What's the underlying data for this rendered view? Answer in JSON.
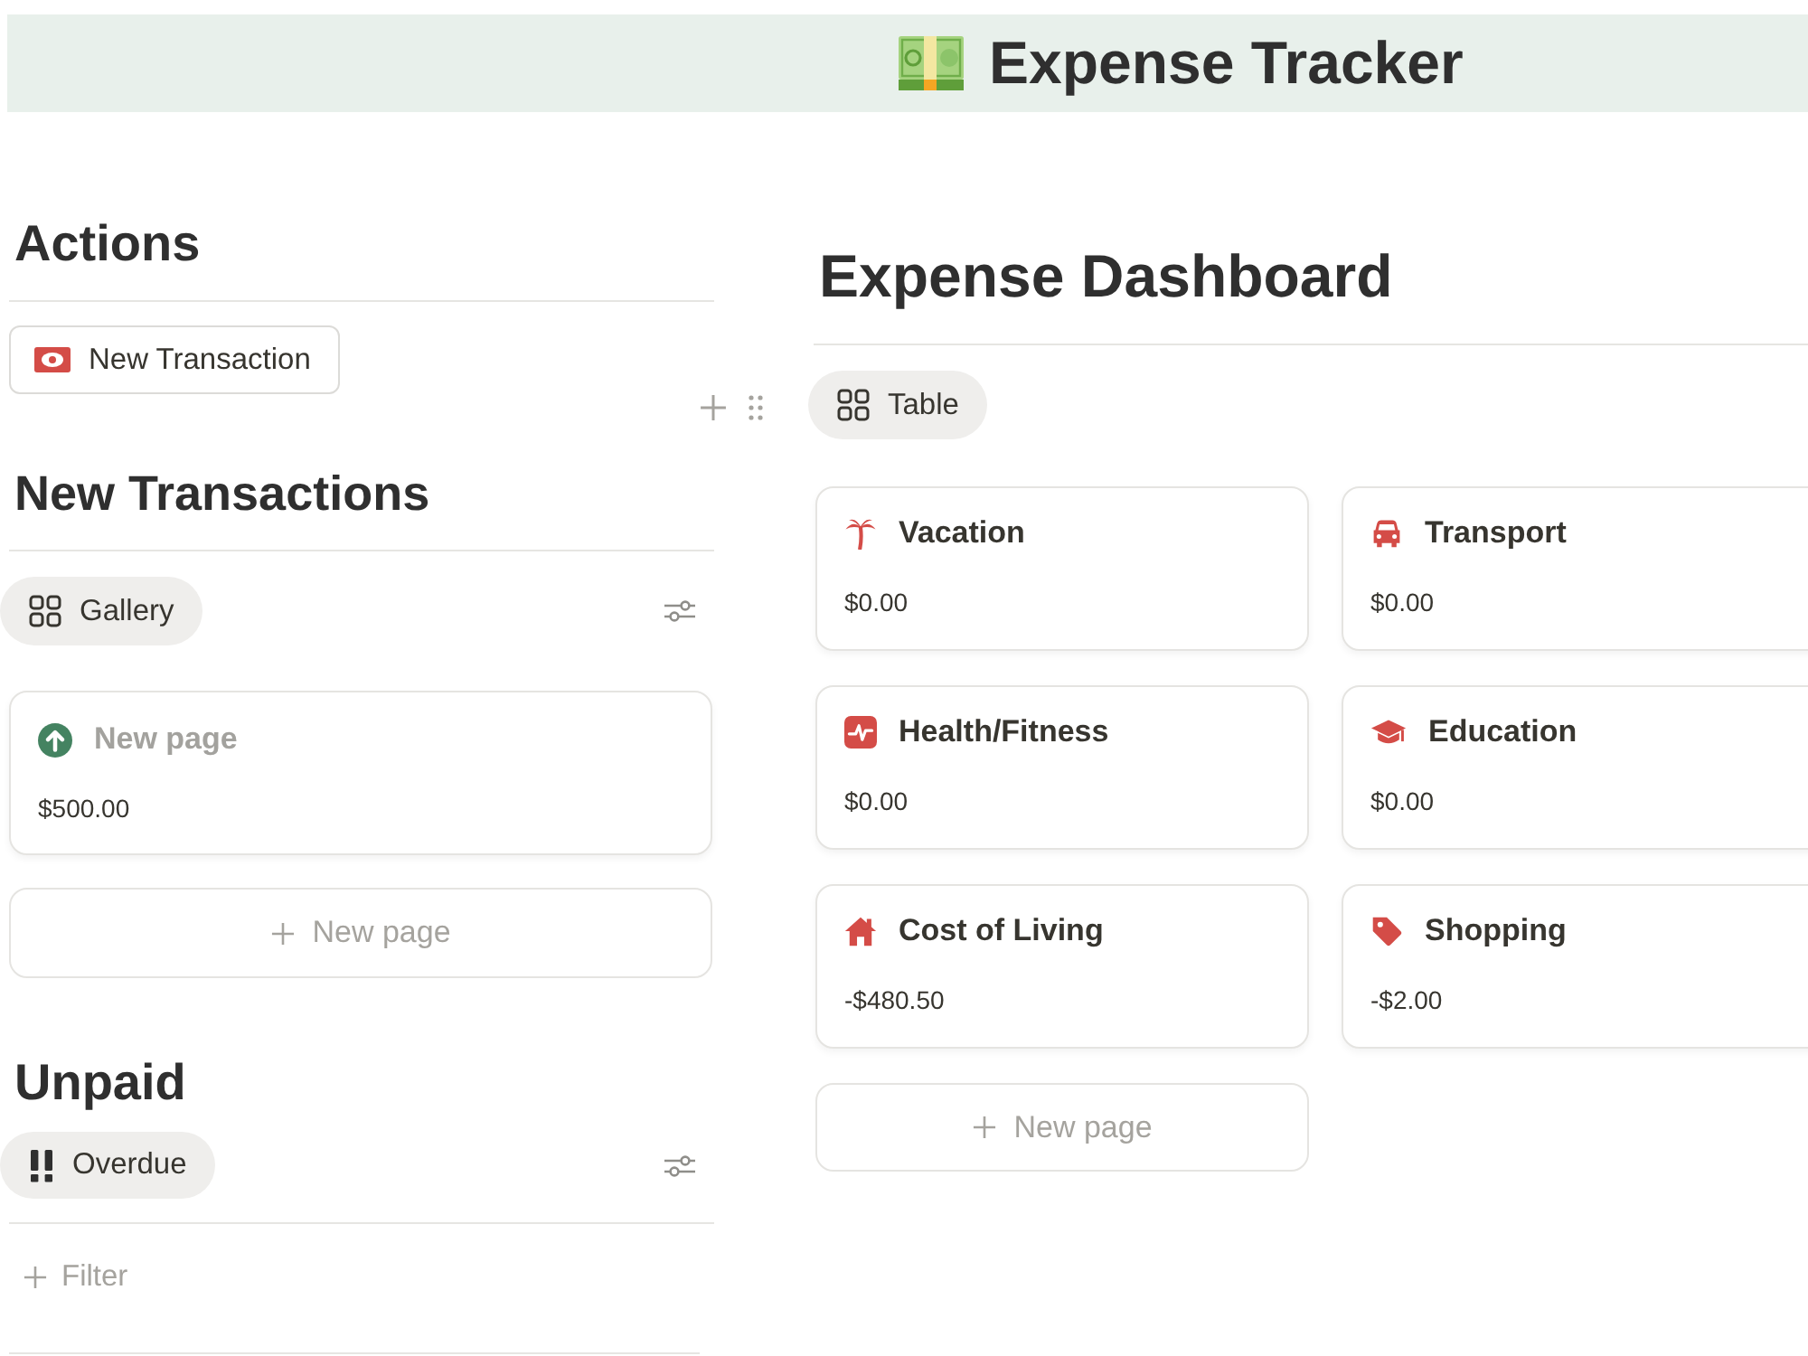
{
  "header": {
    "title": "Expense Tracker"
  },
  "actions": {
    "heading": "Actions",
    "buttons": [
      {
        "label": "New Transaction"
      }
    ]
  },
  "new_transactions": {
    "heading": "New Transactions",
    "view": {
      "label": "Gallery",
      "selected": true
    },
    "cards": [
      {
        "title": "New page",
        "untitled": true,
        "amount": "$500.00"
      }
    ],
    "new_page": "New page"
  },
  "unpaid": {
    "heading": "Unpaid",
    "view": {
      "label": "Overdue",
      "selected": true
    },
    "filter": "Filter"
  },
  "dashboard": {
    "heading": "Expense Dashboard",
    "view": {
      "label": "Table",
      "selected": true
    },
    "cards": [
      {
        "title": "Vacation",
        "untitled": false,
        "amount": "$0.00"
      },
      {
        "title": "Transport",
        "untitled": false,
        "amount": "$0.00"
      },
      {
        "title": "Health/Fitness",
        "untitled": false,
        "amount": "$0.00"
      },
      {
        "title": "Education",
        "untitled": false,
        "amount": "$0.00"
      },
      {
        "title": "Cost of Living",
        "untitled": false,
        "amount": "-$480.50"
      },
      {
        "title": "Shopping",
        "untitled": false,
        "amount": "-$2.00"
      }
    ],
    "new_page": "New page"
  }
}
